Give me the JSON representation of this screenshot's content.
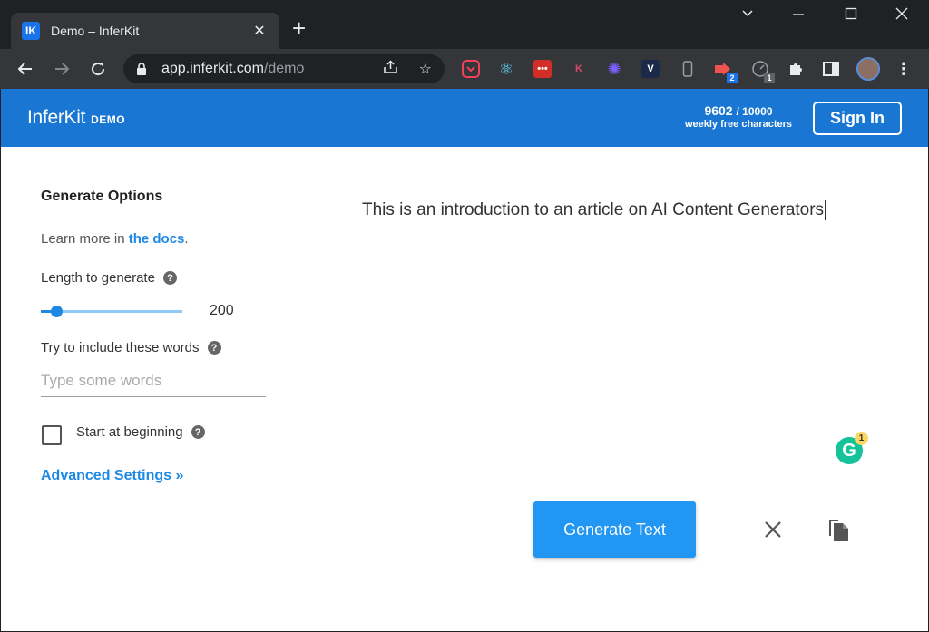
{
  "browser": {
    "tab_favicon": "IK",
    "tab_title": "Demo – InferKit",
    "url_host": "app.inferkit.com",
    "url_path": "/demo",
    "extensions": [
      {
        "name": "pocket-icon",
        "color": "#ef4056"
      },
      {
        "name": "react-icon",
        "color": "#61dafb"
      },
      {
        "name": "lastpass-icon",
        "color": "#d32d27"
      },
      {
        "name": "k-extension-icon",
        "color": "#8b1b2e"
      },
      {
        "name": "spark-icon",
        "color": "#7b61ff"
      },
      {
        "name": "v-extension-icon",
        "color": "#1b2a4a"
      },
      {
        "name": "phone-icon",
        "color": "#9aa0a6"
      },
      {
        "name": "arrow-extension-icon",
        "color": "#ef5350",
        "badge": "2"
      },
      {
        "name": "speed-extension-icon",
        "color": "#9aa0a6",
        "badge": "1"
      }
    ]
  },
  "app": {
    "brand": "InferKit",
    "brand_tag": "DEMO",
    "quota_used": "9602",
    "quota_total": "/ 10000",
    "quota_caption": "weekly free characters",
    "sign_in": "Sign In"
  },
  "options": {
    "title": "Generate Options",
    "learn_prefix": "Learn more in ",
    "learn_link": "the docs",
    "learn_suffix": ".",
    "length_label": "Length to generate",
    "length_value": "200",
    "length_fraction": 0.11,
    "words_label": "Try to include these words",
    "words_placeholder": "Type some words",
    "start_label": "Start at beginning",
    "start_checked": false,
    "advanced": "Advanced Settings »"
  },
  "editor": {
    "text": "This is an introduction to an article on AI Content Generators"
  },
  "grammarly": {
    "badge": "1"
  },
  "actions": {
    "generate": "Generate Text"
  },
  "colors": {
    "header": "#1976d2",
    "accent": "#2196f3",
    "link": "#1e88e5"
  }
}
